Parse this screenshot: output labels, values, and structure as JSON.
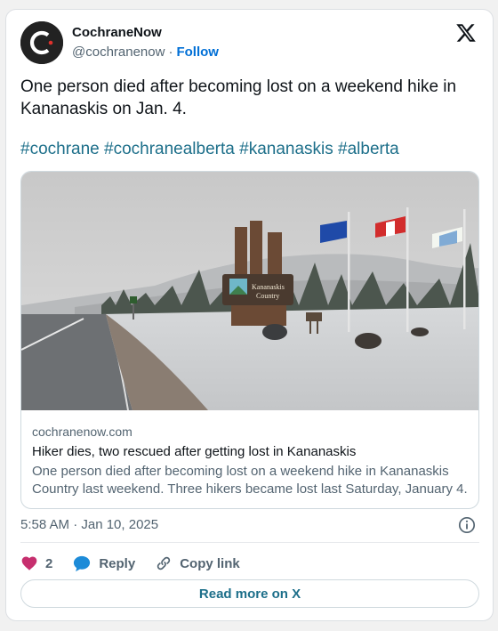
{
  "author": {
    "name": "CochraneNow",
    "handle": "@cochranenow",
    "separator": "·",
    "follow_label": "Follow",
    "avatar_icon": "cochrane-now-logo"
  },
  "brand_icon": "x-logo-icon",
  "tweet": {
    "text": "One person died after becoming lost on a weekend hike in Kananaskis on Jan. 4.",
    "hashtags": [
      "#cochrane",
      "#cochranealberta",
      "#kananaskis",
      "#alberta"
    ]
  },
  "link_card": {
    "domain": "cochranenow.com",
    "title": "Hiker dies, two rescued after getting lost in Kananaskis",
    "description": "One person died after becoming lost on a weekend hike in Kananaskis Country last weekend. Three hikers became lost last Saturday, January 4.",
    "image_sign_text": "Kananaskis Country"
  },
  "timestamp": "5:58 AM · Jan 10, 2025",
  "actions": {
    "like_count": "2",
    "reply_label": "Reply",
    "copy_label": "Copy link"
  },
  "read_more_label": "Read more on X",
  "colors": {
    "link": "#006fd6",
    "hashtag": "#1d6f8a",
    "like": "#c62f6e",
    "reply": "#1d8bd8"
  }
}
